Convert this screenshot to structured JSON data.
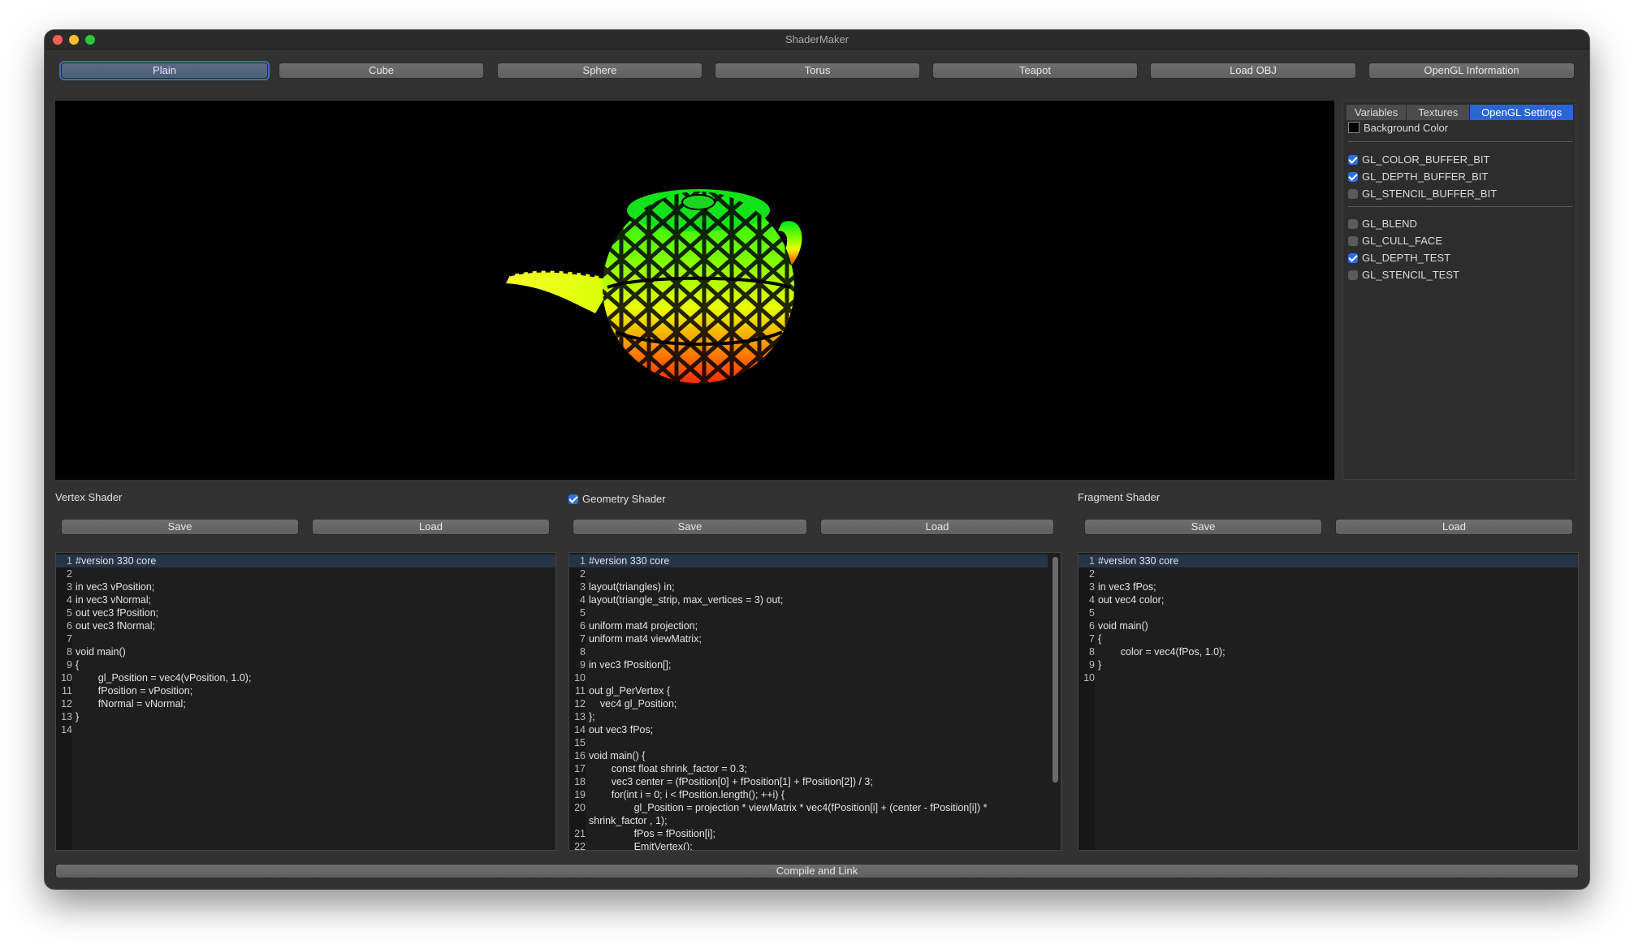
{
  "window": {
    "title": "ShaderMaker"
  },
  "toolbar": [
    "Plain",
    "Cube",
    "Sphere",
    "Torus",
    "Teapot",
    "Load OBJ",
    "OpenGL Information"
  ],
  "side_panel": {
    "tabs": [
      "Variables",
      "Textures",
      "OpenGL Settings"
    ],
    "background_color_label": "Background Color",
    "buffer_options": [
      {
        "label": "GL_COLOR_BUFFER_BIT",
        "checked": true
      },
      {
        "label": "GL_DEPTH_BUFFER_BIT",
        "checked": true
      },
      {
        "label": "GL_STENCIL_BUFFER_BIT",
        "checked": false
      }
    ],
    "state_options": [
      {
        "label": "GL_BLEND",
        "checked": false
      },
      {
        "label": "GL_CULL_FACE",
        "checked": false
      },
      {
        "label": "GL_DEPTH_TEST",
        "checked": true
      },
      {
        "label": "GL_STENCIL_TEST",
        "checked": false
      }
    ]
  },
  "vertex": {
    "label": "Vertex Shader",
    "save": "Save",
    "load": "Load",
    "lines": [
      "#version 330 core",
      "",
      "in vec3 vPosition;",
      "in vec3 vNormal;",
      "out vec3 fPosition;",
      "out vec3 fNormal;",
      "",
      "void main()",
      "{",
      "        gl_Position = vec4(vPosition, 1.0);",
      "        fPosition = vPosition;",
      "        fNormal = vNormal;",
      "}",
      ""
    ]
  },
  "geometry": {
    "label": "Geometry Shader",
    "enabled": true,
    "save": "Save",
    "load": "Load",
    "lines": [
      "#version 330 core",
      "",
      "layout(triangles) in;",
      "layout(triangle_strip, max_vertices = 3) out;",
      "",
      "uniform mat4 projection;",
      "uniform mat4 viewMatrix;",
      "",
      "in vec3 fPosition[];",
      "",
      "out gl_PerVertex {",
      "    vec4 gl_Position;",
      "};",
      "out vec3 fPos;",
      "",
      "void main() {",
      "        const float shrink_factor = 0.3;",
      "        vec3 center = (fPosition[0] + fPosition[1] + fPosition[2]) / 3;",
      "        for(int i = 0; i < fPosition.length(); ++i) {",
      "                gl_Position = projection * viewMatrix * vec4(fPosition[i] + (center - fPosition[i]) *",
      "shrink_factor , 1);",
      "                fPos = fPosition[i];",
      "                EmitVertex();"
    ]
  },
  "fragment": {
    "label": "Fragment Shader",
    "save": "Save",
    "load": "Load",
    "lines": [
      "#version 330 core",
      "",
      "in vec3 fPos;",
      "out vec4 color;",
      "",
      "void main()",
      "{",
      "        color = vec4(fPos, 1.0);",
      "}",
      ""
    ]
  },
  "compile_label": "Compile and Link"
}
